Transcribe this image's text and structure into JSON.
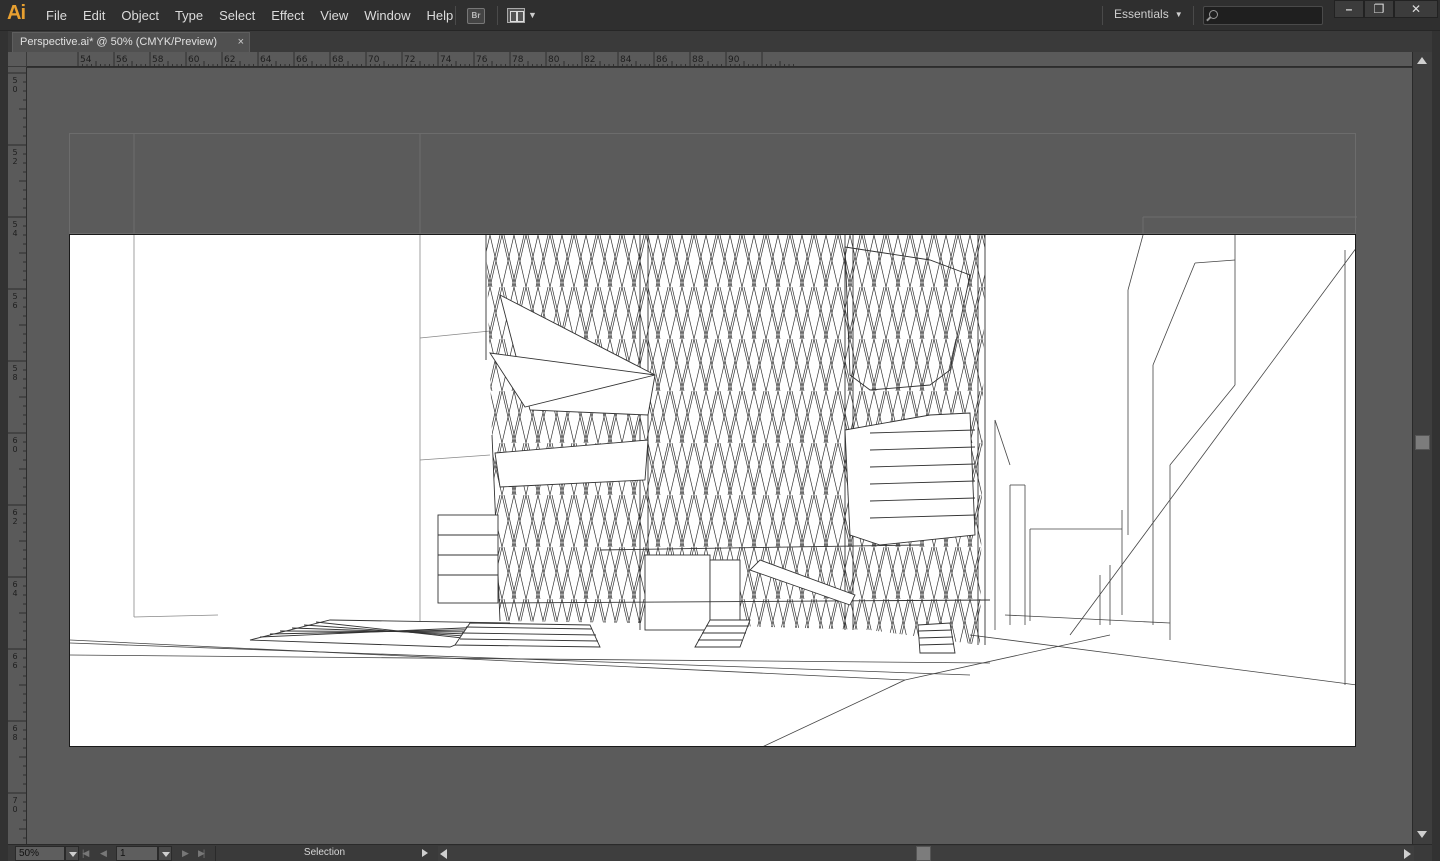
{
  "app": {
    "logo": "Ai",
    "menus": [
      "File",
      "Edit",
      "Object",
      "Type",
      "Select",
      "Effect",
      "View",
      "Window",
      "Help"
    ],
    "bridge_label": "Br",
    "workspace": "Essentials",
    "search_placeholder": "",
    "window_controls": {
      "minimize": "–",
      "restore": "❐",
      "close": "✕"
    }
  },
  "document": {
    "tab_title": "Perspective.ai* @ 50% (CMYK/Preview)",
    "tab_close": "×"
  },
  "rulers": {
    "horizontal": [
      "54",
      "56",
      "58",
      "60",
      "62",
      "64",
      "66",
      "68",
      "70",
      "72",
      "74",
      "76",
      "78",
      "80",
      "82",
      "84",
      "86",
      "88",
      "90"
    ],
    "vertical": [
      "50",
      "52",
      "54",
      "56",
      "58",
      "60",
      "62",
      "64",
      "66",
      "68",
      "70"
    ]
  },
  "statusbar": {
    "zoom": "50%",
    "page": "1",
    "status_text": "Selection"
  },
  "colors": {
    "accent_logo": "#e8a030",
    "pasteboard": "#5b5b5b",
    "artboard": "#ffffff",
    "chrome": "#323232"
  }
}
